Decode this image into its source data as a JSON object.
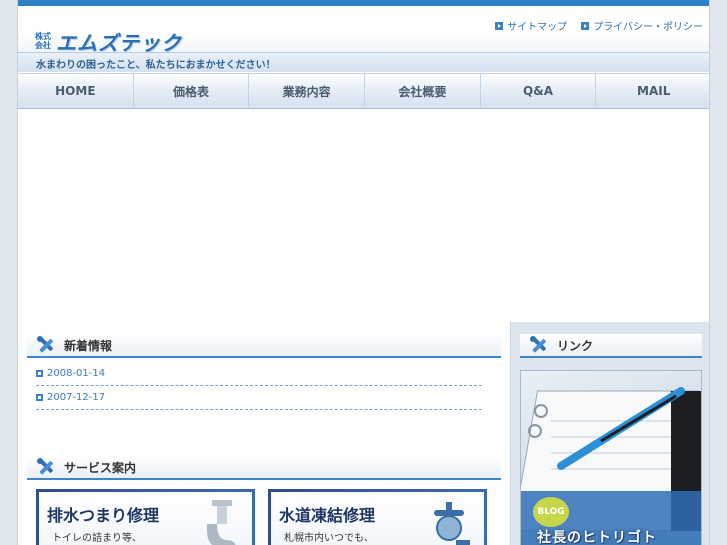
{
  "header": {
    "logo_kabu_top": "株式",
    "logo_kabu_bottom": "会社",
    "logo_name": "エムズテック",
    "tagline": "水まわりの困ったこと、私たちにおまかせください！",
    "util_links": [
      "サイトマップ",
      "プライバシー・ポリシー"
    ]
  },
  "nav": {
    "items": [
      "HOME",
      "価格表",
      "業務内容",
      "会社概要",
      "Q&A",
      "MAIL"
    ]
  },
  "news": {
    "title": "新着情報",
    "items": [
      "2008-01-14",
      "2007-12-17"
    ]
  },
  "services": {
    "title": "サービス案内",
    "cards": [
      {
        "title": "排水つまり修理",
        "text": "トイレの詰まり等、"
      },
      {
        "title": "水道凍結修理",
        "text": "札幌市内いつでも、"
      }
    ]
  },
  "side": {
    "title": "リンク",
    "blog_badge": "BLOG",
    "blog_title": "社長のヒトリゴト"
  },
  "colors": {
    "accent": "#2e80c6",
    "link": "#3c79c0",
    "nav_text": "#4a5d70"
  }
}
